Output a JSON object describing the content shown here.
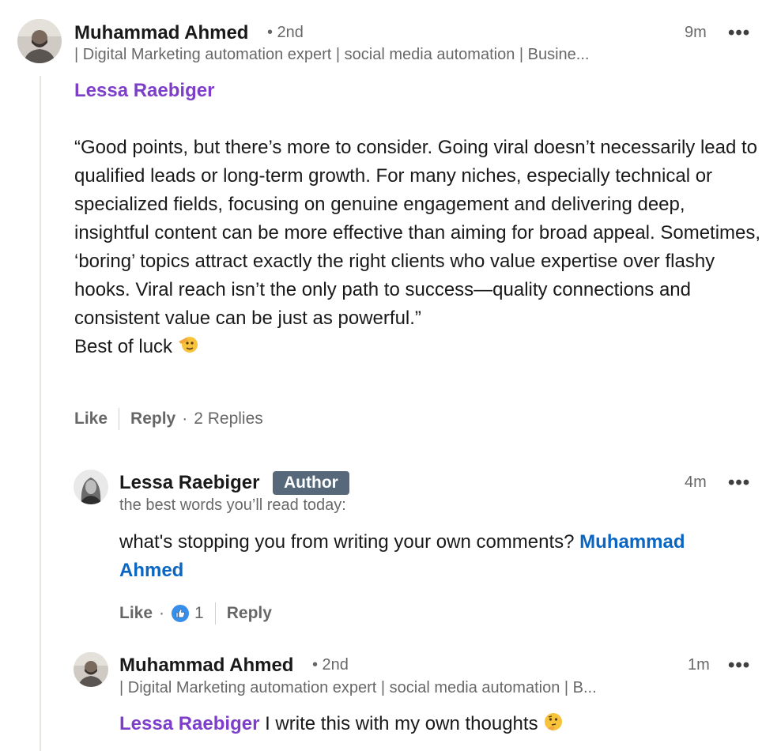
{
  "comment": {
    "author": "Muhammad Ahmed",
    "degree": "• 2nd",
    "headline": "| Digital Marketing automation expert | social media automation | Busine...",
    "time": "9m",
    "mention": "Lessa Raebiger",
    "body": "“Good points, but there’s more to consider. Going viral doesn’t necessarily lead to qualified leads or long-term growth. For many niches, especially technical or specialized fields, focusing on genuine engagement and delivering deep, insightful content can be more effective than aiming for broad appeal. Sometimes, ‘boring’ topics attract exactly the right clients who value expertise over flashy hooks. Viral reach isn’t the only path to success—quality connections and consistent value can be just as powerful.”",
    "closing": "Best of luck",
    "closing_emoji": "salute-emoji",
    "like_label": "Like",
    "reply_label": "Reply",
    "replies_count": "2 Replies",
    "more_icon": "more-options-icon"
  },
  "reply1": {
    "author": "Lessa Raebiger",
    "badge": "Author",
    "headline": "the best words you’ll read today:",
    "time": "4m",
    "body": "what's stopping you from writing your own comments?",
    "mention": "Muhammad Ahmed",
    "like_label": "Like",
    "reaction_icon": "thumbs-up-icon",
    "reaction_count": "1",
    "reply_label": "Reply"
  },
  "reply2": {
    "author": "Muhammad Ahmed",
    "degree": "• 2nd",
    "headline": "| Digital Marketing automation expert | social media automation | B...",
    "time": "1m",
    "mention": "Lessa Raebiger",
    "body": "I write this with my own thoughts",
    "emoji": "thinking-face-emoji"
  },
  "colors": {
    "mention_purple": "#7d3ec9",
    "mention_blue": "#0a66c2",
    "badge_bg": "#56687a",
    "thread_line": "#e8e6e1"
  }
}
